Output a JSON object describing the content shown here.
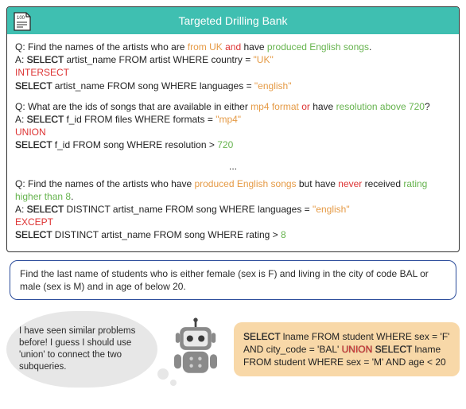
{
  "header": {
    "title": "Targeted Drilling Bank",
    "icon_label": "100"
  },
  "ellipsis": "...",
  "examples": [
    {
      "q_prefix": "Q: Find the names of the artists who are ",
      "q_seg1": "from UK",
      "q_conj": " and ",
      "q_seg2": "have ",
      "q_seg3": "produced English songs",
      "q_suffix": ".",
      "a_line1_pre": "A: ",
      "a_line1_kw": "SELECT",
      "a_line1_mid": " artist_name FROM artist WHERE country  = ",
      "a_line1_val": "\"UK\"",
      "op": "INTERSECT",
      "a_line2_kw": "SELECT",
      "a_line2_mid": " artist_name FROM song WHERE languages  =  ",
      "a_line2_val": "\"english\""
    },
    {
      "q_prefix": "Q: What are the ids of songs that are available in either ",
      "q_seg1": "mp4 format",
      "q_conj": " or ",
      "q_seg2": "have ",
      "q_seg3": "resolution above 720",
      "q_suffix": "?",
      "a_line1_pre": "A: ",
      "a_line1_kw": "SELECT",
      "a_line1_mid": " f_id FROM files WHERE formats = ",
      "a_line1_val": "\"mp4\"",
      "op": "UNION",
      "a_line2_kw": "SELECT",
      "a_line2_mid": " f_id FROM song WHERE resolution  >  ",
      "a_line2_val": "720"
    },
    {
      "q_prefix": "Q: Find the names of the artists who have ",
      "q_seg1": "produced English songs",
      "q_conj": " but have ",
      "q_seg2_red": "never",
      "q_seg3_pre": " received ",
      "q_seg3": "rating higher than 8",
      "q_suffix": ".",
      "a_line1_pre": "A: ",
      "a_line1_kw": "SELECT",
      "a_line1_mid": " DISTINCT artist_name FROM song WHERE languages  =  ",
      "a_line1_val": "\"english\"",
      "op": "EXCEPT",
      "a_line2_kw": "SELECT",
      "a_line2_mid": " DISTINCT artist_name FROM song WHERE rating  >  ",
      "a_line2_val": "8"
    }
  ],
  "task": {
    "text": "Find the last name of students who is either female (sex is F) and living in the city of code BAL or male (sex is M) and in age of below 20."
  },
  "thought": {
    "text": "I have seen similar problems before! I guess I should use 'union' to connect the two subqueries."
  },
  "answer": {
    "kw1": "SELECT",
    "part1": " lname FROM student WHERE sex  =  'F' AND city_code  =  'BAL' ",
    "op": "UNION",
    "space": " ",
    "kw2": "SELECT",
    "part2": " lname FROM student WHERE sex  =  'M' AND age  <  20"
  },
  "chart_data": {
    "type": "table",
    "title": "Targeted Drilling Bank",
    "columns": [
      "question",
      "sql_answer"
    ],
    "rows": [
      {
        "question": "Find the names of the artists who are from UK and have produced English songs.",
        "sql_answer": "SELECT artist_name FROM artist WHERE country = \"UK\" INTERSECT SELECT artist_name FROM song WHERE languages = \"english\""
      },
      {
        "question": "What are the ids of songs that are available in either mp4 format or have resolution above 720?",
        "sql_answer": "SELECT f_id FROM files WHERE formats = \"mp4\" UNION SELECT f_id FROM song WHERE resolution > 720"
      },
      {
        "question": "Find the names of the artists who have produced English songs but have never received rating higher than 8.",
        "sql_answer": "SELECT DISTINCT artist_name FROM song WHERE languages = \"english\" EXCEPT SELECT DISTINCT artist_name FROM song WHERE rating > 8"
      }
    ],
    "task_question": "Find the last name of students who is either female (sex is F) and living in the city of code BAL or male (sex is M) and in age of below 20.",
    "task_answer": "SELECT lname FROM student WHERE sex = 'F' AND city_code = 'BAL' UNION SELECT lname FROM student WHERE sex = 'M' AND age < 20"
  }
}
